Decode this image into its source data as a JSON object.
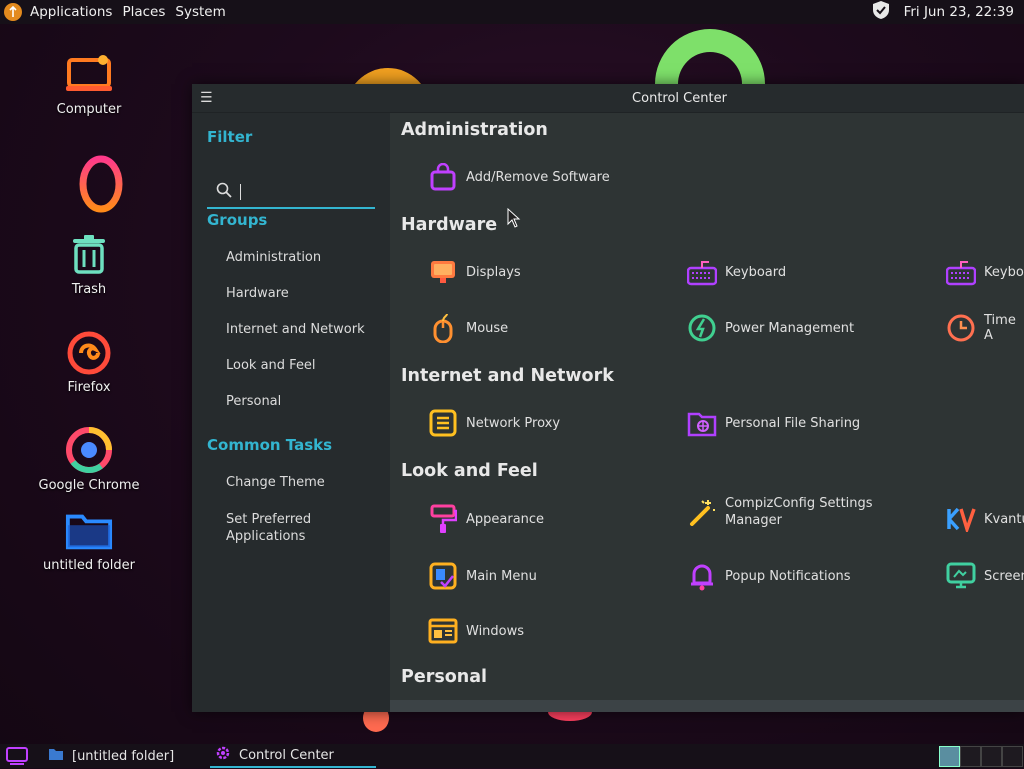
{
  "top_panel": {
    "menu": [
      "Applications",
      "Places",
      "System"
    ],
    "clock": "Fri Jun 23, 22:39"
  },
  "desktop_icons": [
    {
      "label": "Computer",
      "icon": "computer-icon"
    },
    {
      "label": "Trash",
      "icon": "trash-icon"
    },
    {
      "label": "Firefox",
      "icon": "firefox-icon"
    },
    {
      "label": "Google Chrome",
      "icon": "chrome-icon"
    },
    {
      "label": "untitled folder",
      "icon": "folder-icon"
    }
  ],
  "window": {
    "title": "Control Center",
    "sidebar": {
      "filter_heading": "Filter",
      "search_value": "",
      "groups_heading": "Groups",
      "groups": [
        "Administration",
        "Hardware",
        "Internet and Network",
        "Look and Feel",
        "Personal"
      ],
      "tasks_heading": "Common Tasks",
      "tasks": [
        "Change Theme",
        "Set Preferred",
        "Applications"
      ]
    },
    "sections": {
      "administration": {
        "title": "Administration",
        "items": [
          "Add/Remove Software"
        ]
      },
      "hardware": {
        "title": "Hardware",
        "items": [
          "Displays",
          "Keyboard",
          "Keybo",
          "Mouse",
          "Power Management",
          "Time A"
        ]
      },
      "internet": {
        "title": "Internet and Network",
        "items": [
          "Network Proxy",
          "Personal File Sharing"
        ]
      },
      "look": {
        "title": "Look and Feel",
        "items": [
          "Appearance",
          "CompizConfig Settings",
          "Manager",
          "Kvantu",
          "Main Menu",
          "Popup Notifications",
          "Screen",
          "Windows"
        ]
      },
      "personal": {
        "title": "Personal"
      }
    }
  },
  "taskbar": {
    "tasks": [
      "[untitled folder]",
      "Control Center"
    ]
  },
  "colors": {
    "accent": "#33b5d0",
    "window_bg": "#2e3434",
    "sidebar_bg": "#262b2d"
  }
}
